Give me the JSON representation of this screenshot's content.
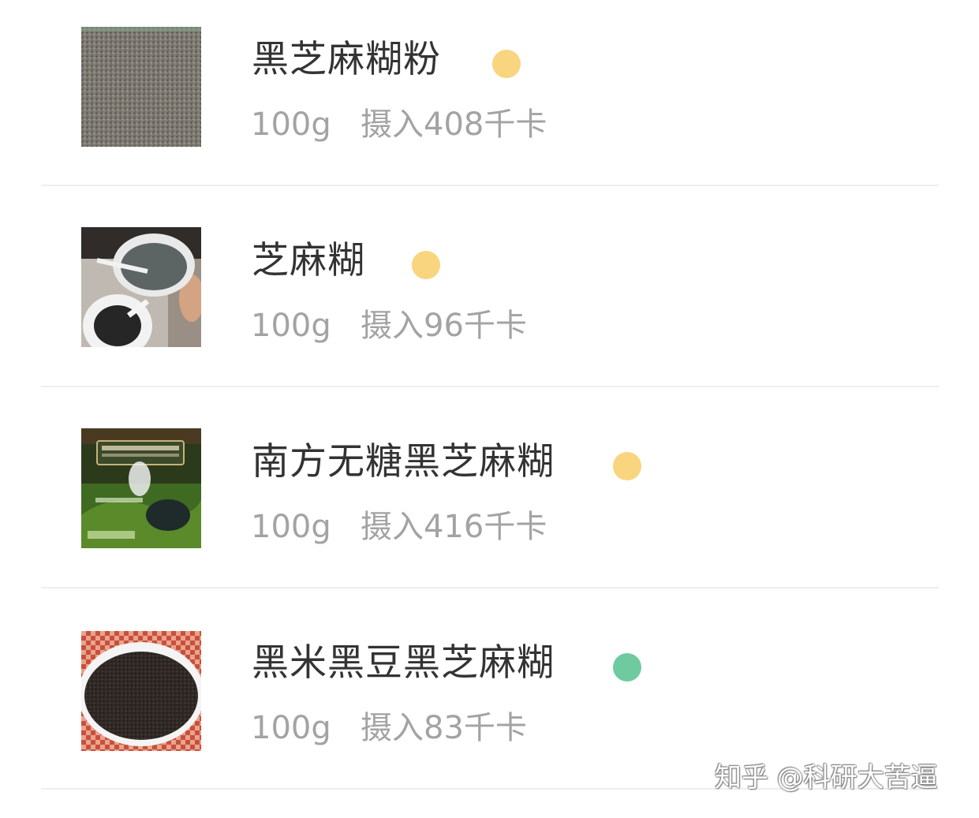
{
  "items": [
    {
      "name": "黑芝麻糊粉",
      "portion": "100g",
      "calories": "摄入408千卡",
      "indicator_color": "#f8d57e",
      "image_icon": "sesame-powder-photo-icon"
    },
    {
      "name": "芝麻糊",
      "portion": "100g",
      "calories": "摄入96千卡",
      "indicator_color": "#f8d57e",
      "image_icon": "sesame-paste-cups-photo-icon"
    },
    {
      "name": "南方无糖黑芝麻糊",
      "portion": "100g",
      "calories": "摄入416千卡",
      "indicator_color": "#f8d57e",
      "image_icon": "nanfang-package-photo-icon"
    },
    {
      "name": "黑米黑豆黑芝麻糊",
      "portion": "100g",
      "calories": "摄入83千卡",
      "indicator_color": "#6fcaa0",
      "image_icon": "black-rice-paste-bowl-photo-icon"
    }
  ],
  "watermark": "知乎 @科研大苦逼"
}
